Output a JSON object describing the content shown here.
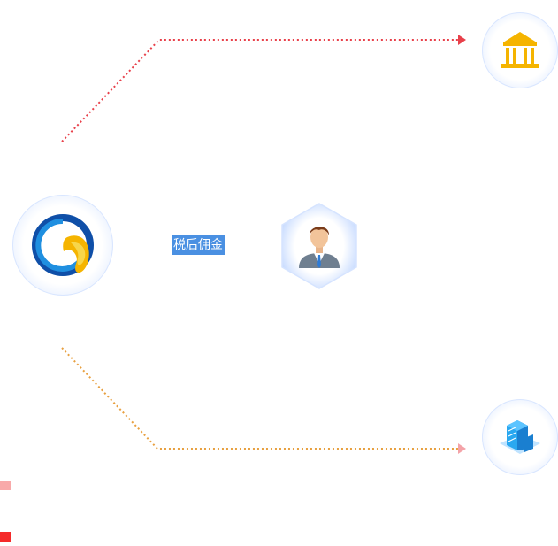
{
  "diagram": {
    "edge_label": "税后佣金"
  },
  "nodes": {
    "source": {
      "icon": "swirl-logo-icon"
    },
    "person": {
      "icon": "businessman-icon"
    },
    "bank": {
      "icon": "bank-icon"
    },
    "company": {
      "icon": "office-building-icon"
    }
  },
  "colors": {
    "top_flow": "#e8404a",
    "bottom_flow": "#e8a040",
    "label_bg": "#4a90e2",
    "legend_light": "#f8a9a9",
    "legend_dark": "#f52a2a"
  },
  "legend": [
    {
      "icon": "legend-swatch-light",
      "color": "#f8a9a9"
    },
    {
      "icon": "legend-swatch-dark",
      "color": "#f52a2a"
    }
  ]
}
